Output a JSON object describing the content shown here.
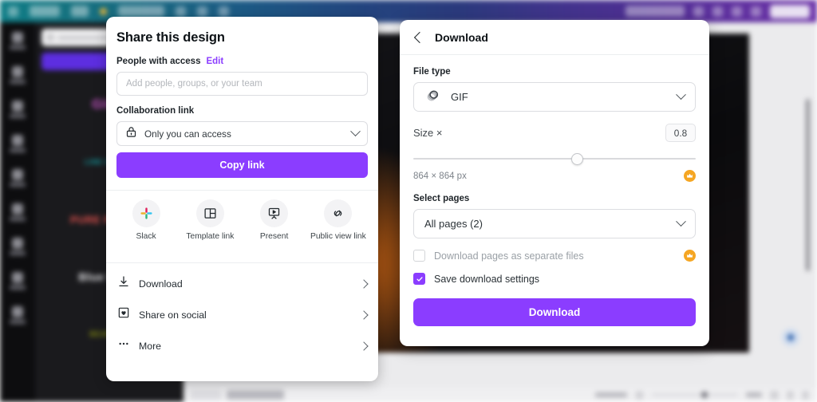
{
  "app": {
    "brand_accent": "#8b3dff",
    "premium_accent": "#f5a623",
    "topbar_gradient_start": "#0e7d86",
    "topbar_gradient_end": "#6b31a8"
  },
  "share_panel": {
    "title": "Share this design",
    "people_section": {
      "label": "People with access",
      "edit_label": "Edit",
      "input_value": "",
      "input_placeholder": "Add people, groups, or your team"
    },
    "collab_section": {
      "label": "Collaboration link",
      "selected": "Only you can access",
      "lock_icon": "lock-icon",
      "chevron_icon": "chevron-down-icon"
    },
    "copy_link_label": "Copy link",
    "quick_actions": [
      {
        "label": "Slack",
        "icon": "slack-icon"
      },
      {
        "label": "Template link",
        "icon": "template-link-icon"
      },
      {
        "label": "Present",
        "icon": "present-icon"
      },
      {
        "label": "Public view link",
        "icon": "public-view-link-icon"
      }
    ],
    "menu_items": [
      {
        "label": "Download",
        "icon": "download-icon",
        "chevron": "chevron-right-icon"
      },
      {
        "label": "Share on social",
        "icon": "share-social-icon",
        "chevron": "chevron-right-icon"
      },
      {
        "label": "More",
        "icon": "ellipsis-icon",
        "chevron": "chevron-right-icon"
      }
    ]
  },
  "download_panel": {
    "back_icon": "chevron-left-icon",
    "title": "Download",
    "file_type": {
      "label": "File type",
      "selected": "GIF",
      "icon": "gif-icon",
      "chevron_icon": "chevron-down-icon"
    },
    "size": {
      "label": "Size ×",
      "value": "0.8",
      "slider_percent": 58,
      "dimensions": "864 × 864 px",
      "premium_icon": "crown-icon"
    },
    "select_pages": {
      "label": "Select pages",
      "selected": "All pages (2)",
      "chevron_icon": "chevron-down-icon"
    },
    "options": [
      {
        "label": "Download pages as separate files",
        "checked": false,
        "disabled": true,
        "premium_icon": "crown-icon"
      },
      {
        "label": "Save download settings",
        "checked": true,
        "disabled": false
      }
    ],
    "download_button_label": "Download"
  },
  "background": {
    "sidebar_tiles": [
      {
        "text": "Glow",
        "color": "#d158d1",
        "bg": "#1a1a1d"
      },
      {
        "text": "LINE OF THE",
        "color": "#14a3a8",
        "bg": "#1a1a1d"
      },
      {
        "text": "PURE PEOPLE",
        "color": "#e8534f",
        "bg": "#1a1a1d"
      },
      {
        "text": "Blue Wood",
        "color": "#e9e9ec",
        "bg": "#1a1a1d"
      },
      {
        "text": "SCATTER",
        "color": "#9aa312",
        "bg": "#1a1a1d"
      }
    ],
    "rail_item_count": 9
  }
}
